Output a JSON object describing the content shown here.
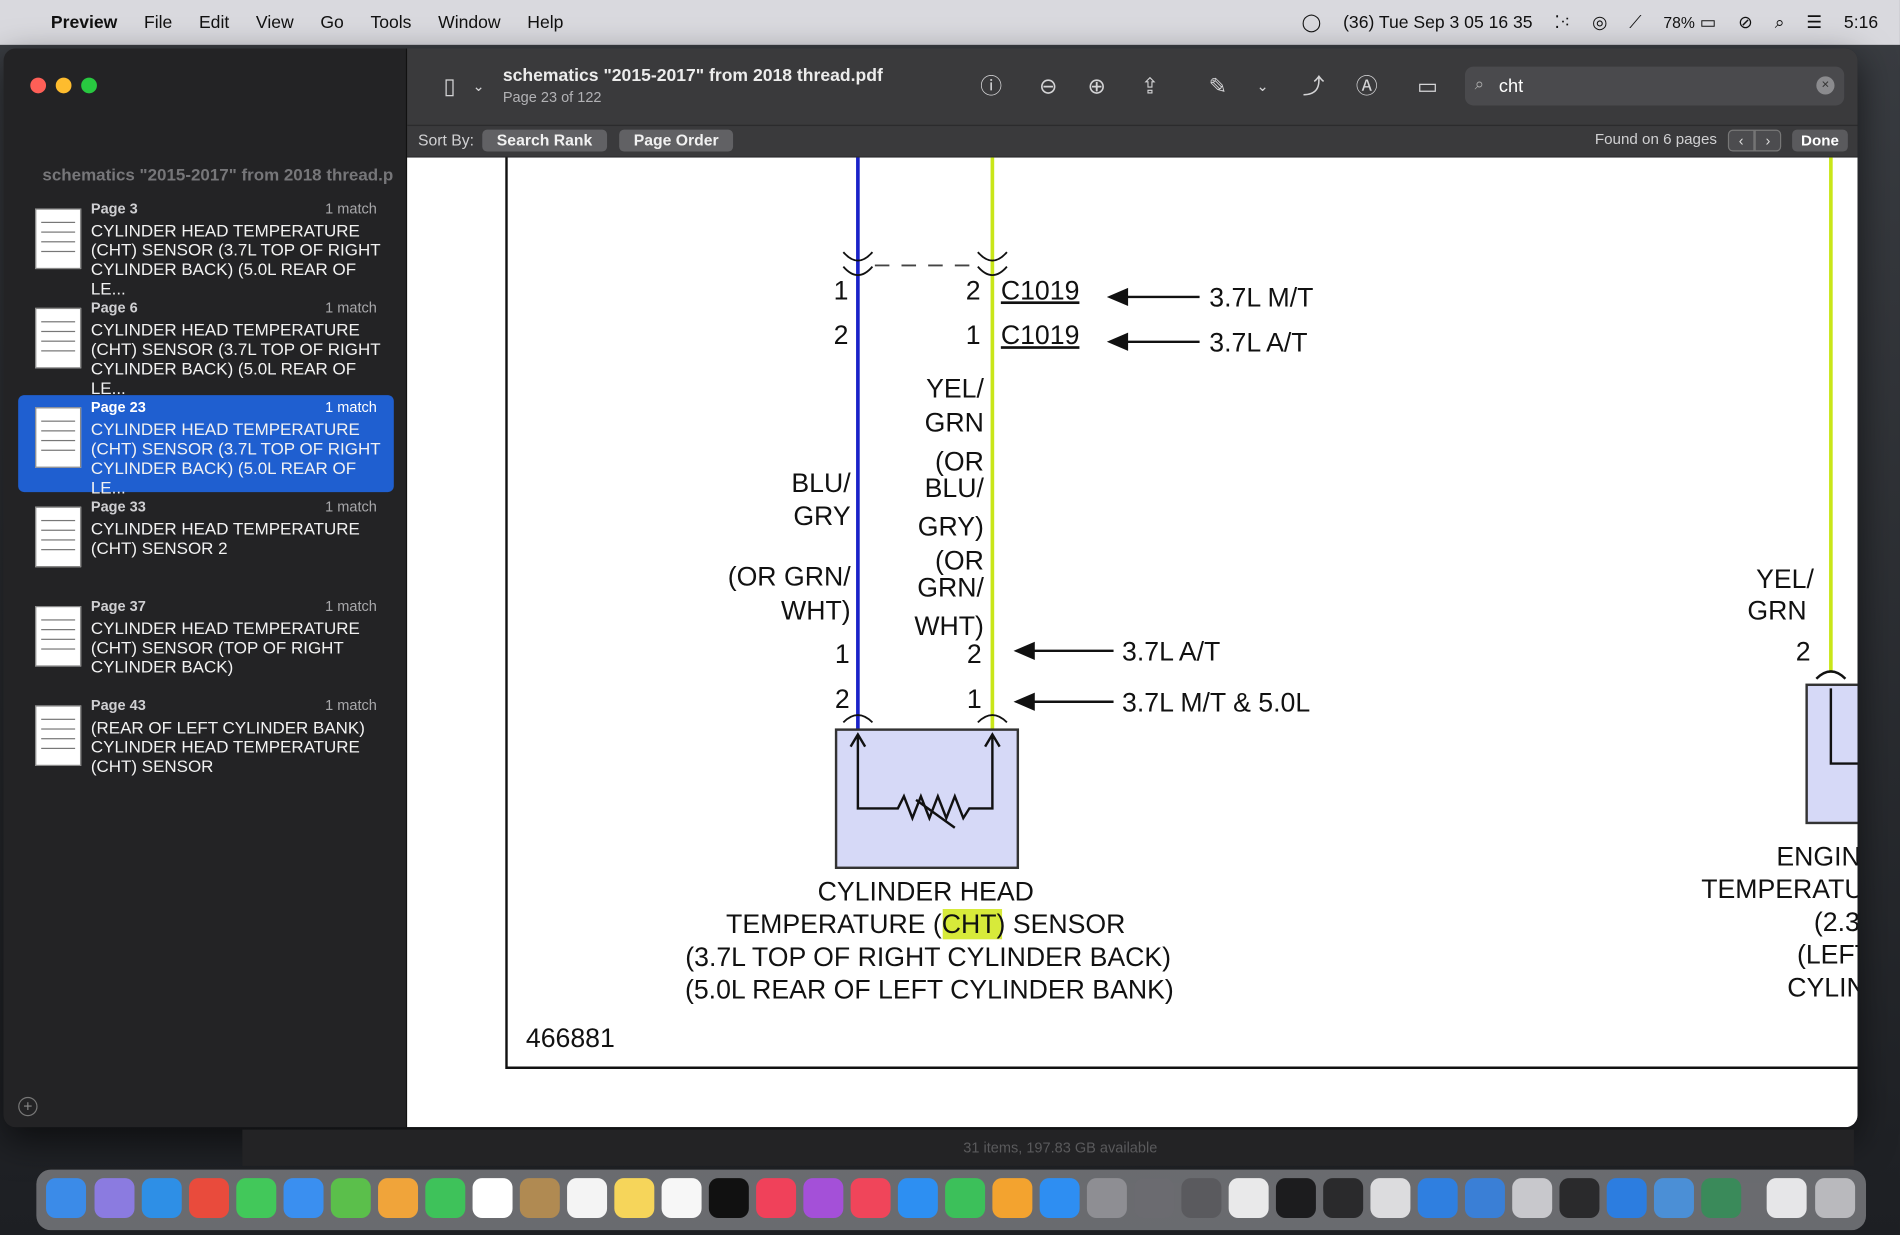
{
  "menubar": {
    "app_name": "Preview",
    "menus": [
      "File",
      "Edit",
      "View",
      "Go",
      "Tools",
      "Window",
      "Help"
    ],
    "status_text": "(36) Tue Sep 3  05 16 35",
    "battery": "78%",
    "clock": "5:16"
  },
  "sidebar": {
    "doc_title": "schematics \"2015-2017\" from 2018 thread.p",
    "results": [
      {
        "page": "Page 3",
        "matches": "1 match",
        "text": "CYLINDER HEAD TEMPERATURE (CHT) SENSOR (3.7L TOP OF RIGHT CYLINDER BACK) (5.0L REAR OF LE..."
      },
      {
        "page": "Page 6",
        "matches": "1 match",
        "text": "CYLINDER HEAD TEMPERATURE (CHT) SENSOR (3.7L TOP OF RIGHT CYLINDER BACK) (5.0L REAR OF LE..."
      },
      {
        "page": "Page 23",
        "matches": "1 match",
        "text": "CYLINDER HEAD TEMPERATURE (CHT) SENSOR (3.7L TOP OF RIGHT CYLINDER BACK) (5.0L REAR OF LE..."
      },
      {
        "page": "Page 33",
        "matches": "1 match",
        "text": "CYLINDER HEAD TEMPERATURE (CHT) SENSOR 2"
      },
      {
        "page": "Page 37",
        "matches": "1 match",
        "text": "CYLINDER HEAD TEMPERATURE (CHT) SENSOR (TOP OF RIGHT CYLINDER BACK)"
      },
      {
        "page": "Page 43",
        "matches": "1 match",
        "text": "(REAR OF LEFT CYLINDER BANK) CYLINDER HEAD TEMPERATURE (CHT) SENSOR"
      }
    ]
  },
  "toolbar": {
    "title": "schematics \"2015-2017\" from 2018 thread.pdf",
    "subtitle": "Page 23 of 122",
    "search_value": "cht"
  },
  "findbar": {
    "sort_label": "Sort By:",
    "search_rank": "Search Rank",
    "page_order": "Page Order",
    "found": "Found on 6 pages",
    "done": "Done"
  },
  "schematic": {
    "pin_labels": [
      "1",
      "2",
      "2",
      "1",
      "1",
      "2",
      "2",
      "1",
      "2"
    ],
    "c1019_a": "C1019",
    "c1019_b": "C1019",
    "arrow_mt": "3.7L M/T",
    "arrow_at": "3.7L A/T",
    "arrow_at2": "3.7L A/T",
    "arrow_mt50": "3.7L M/T & 5.0L",
    "wire1_lines": [
      "BLU/",
      "GRY",
      "(OR GRN/",
      "WHT)"
    ],
    "wire2_lines": [
      "YEL/",
      "GRN",
      "(OR",
      "BLU/",
      "GRY)",
      "(OR",
      "GRN/",
      "WHT)"
    ],
    "wire3_lines": [
      "YEL/",
      "GRN"
    ],
    "caption_line1": "CYLINDER HEAD",
    "caption_pre": "TEMPERATURE (",
    "caption_hl": "CHT",
    "caption_post": ") SENSOR",
    "caption_line3": "(3.7L  TOP OF RIGHT CYLINDER BACK)",
    "caption_line4": "(5.0L  REAR OF LEFT CYLINDER BANK)",
    "right_caption": [
      "ENGIN",
      "TEMPERATU",
      "(2.3",
      "(LEFT",
      "CYLIN"
    ],
    "figure_number": "466881",
    "wire_colors": {
      "blue": "#1a22c8",
      "yellow_green": "#c9e619",
      "sensor_fill": "#d6d9f7"
    }
  },
  "finder": {
    "status": "31 items, 197.83 GB available"
  }
}
